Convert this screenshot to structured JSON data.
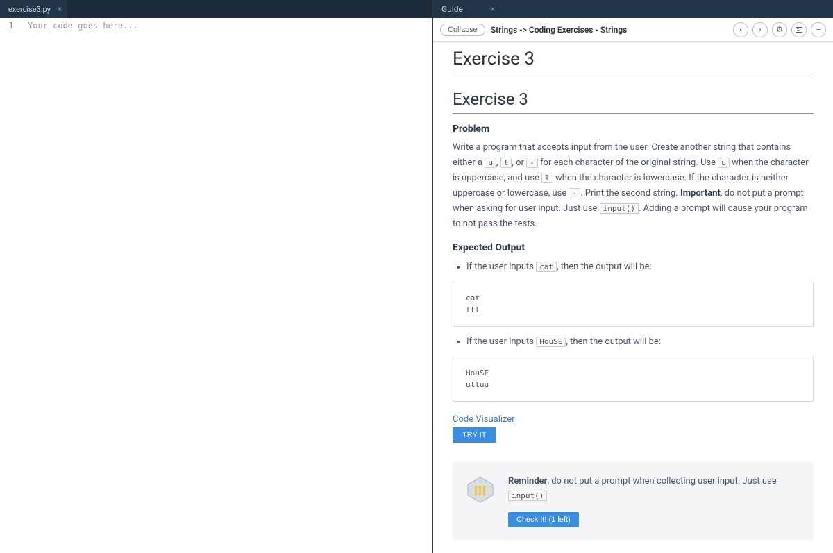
{
  "left": {
    "tab_name": "exercise3.py",
    "line_number": "1",
    "placeholder": "Your code goes here..."
  },
  "right": {
    "tab_name": "Guide",
    "collapse_label": "Collapse",
    "breadcrumb": "Strings -> Coding Exercises - Strings",
    "title": "Exercise 3",
    "section_title": "Exercise 3",
    "problem_heading": "Problem",
    "problem": {
      "t1": "Write a program that accepts input from the user. Create another string that contains either a ",
      "c1": "u",
      "t2": ", ",
      "c2": "l",
      "t3": ", or ",
      "c3": "-",
      "t4": " for each character of the original string. Use ",
      "c4": "u",
      "t5": " when the character is uppercase, and use ",
      "c5": "l",
      "t6": " when the character is lowercase. If the character is neither uppercase or lowercase, use ",
      "c6": "-",
      "t7": ". Print the second string. ",
      "bold1": "Important",
      "t8": ", do not put a prompt when asking for user input. Just use ",
      "c7": "input()",
      "t9": ". Adding a prompt will cause your program to not pass the tests."
    },
    "expected_heading": "Expected Output",
    "ex1": {
      "pre": "If the user inputs ",
      "code": "cat",
      "post": ", then the output will be:",
      "block": "cat\nlll"
    },
    "ex2": {
      "pre": "If the user inputs ",
      "code": "HouSE",
      "post": ", then the output will be:",
      "block": "HouSE\nulluu"
    },
    "visualizer_link": "Code Visualizer",
    "try_label": "TRY IT",
    "reminder": {
      "bold": "Reminder",
      "t1": ", do not put a prompt when collecting user input. Just use ",
      "code": "input()"
    },
    "check_label": "Check It! (1 left)"
  }
}
